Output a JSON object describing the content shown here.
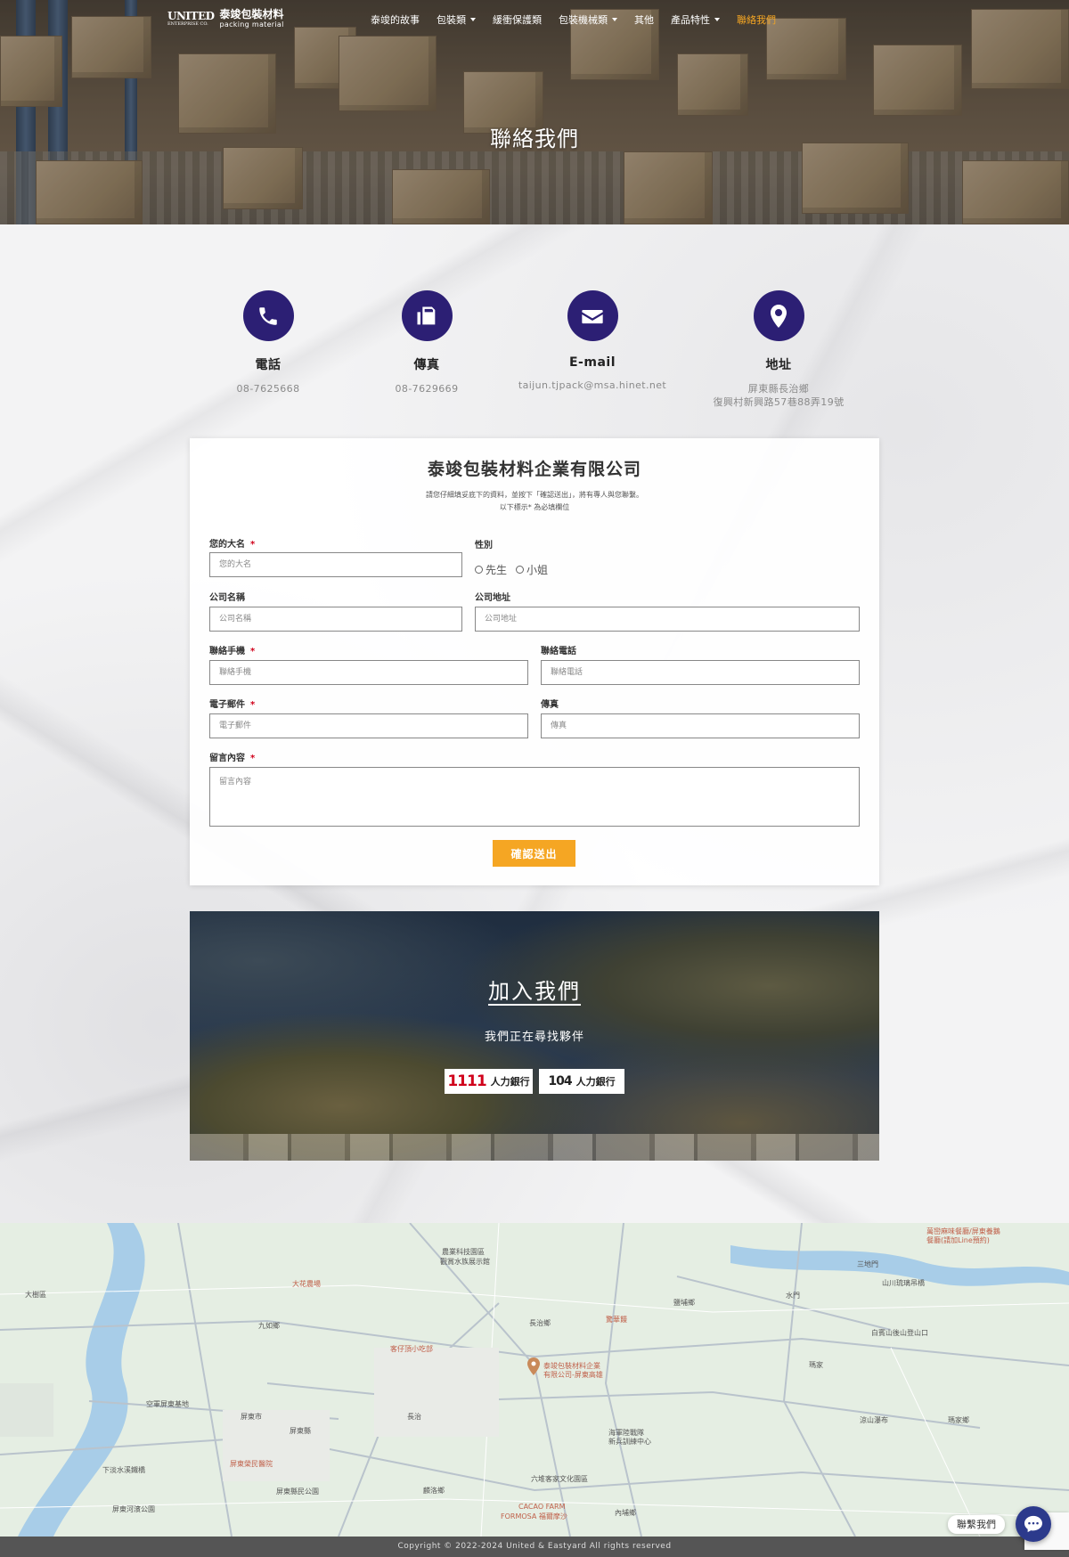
{
  "nav": {
    "logo_mark": "UNITED",
    "logo_mark_sub": "ENTERPRISE CO.",
    "logo_cn": "泰竣包裝材料",
    "logo_en": "packing material",
    "items": [
      {
        "label": "泰竣的故事",
        "dropdown": false
      },
      {
        "label": "包裝類",
        "dropdown": true
      },
      {
        "label": "緩衝保護類",
        "dropdown": false
      },
      {
        "label": "包裝機械類",
        "dropdown": true
      },
      {
        "label": "其他",
        "dropdown": false
      },
      {
        "label": "產品特性",
        "dropdown": true
      },
      {
        "label": "聯絡我們",
        "dropdown": false,
        "active": true
      }
    ]
  },
  "hero": {
    "title": "聯絡我們"
  },
  "contact": [
    {
      "icon": "phone-icon",
      "title": "電話",
      "value": "08-7625668"
    },
    {
      "icon": "fax-icon",
      "title": "傳真",
      "value": "08-7629669"
    },
    {
      "icon": "email-icon",
      "title": "E-mail",
      "value": "taijun.tjpack@msa.hinet.net"
    },
    {
      "icon": "location-pin-icon",
      "title": "地址",
      "value": "屏東縣長治鄉",
      "value2": "復興村新興路57巷88弄19號"
    }
  ],
  "form": {
    "title": "泰竣包裝材料企業有限公司",
    "note1": "請您仔細填妥底下的資料，並按下「確認送出」，將有專人與您聯繫。",
    "note2": "以下標示* 為必填欄位",
    "name_label": "您的大名",
    "name_placeholder": "您的大名",
    "gender_label": "性別",
    "gender_options": [
      "先生",
      "小姐"
    ],
    "company_label": "公司名稱",
    "company_placeholder": "公司名稱",
    "address_label": "公司地址",
    "address_placeholder": "公司地址",
    "mobile_label": "聯絡手機",
    "mobile_placeholder": "聯絡手機",
    "phone_label": "聯絡電話",
    "phone_placeholder": "聯絡電話",
    "email_label": "電子郵件",
    "email_placeholder": "電子郵件",
    "fax_label": "傳真",
    "fax_placeholder": "傳真",
    "message_label": "留言內容",
    "message_placeholder": "留言內容",
    "required_mark": "*",
    "submit_label": "確認送出"
  },
  "join": {
    "title": "加入我們",
    "subtitle": "我們正在尋找夥伴",
    "badges": [
      {
        "num": "1111",
        "text": "人力銀行"
      },
      {
        "num": "104",
        "text": "人力銀行"
      }
    ]
  },
  "map": {
    "labels": {
      "l1": "大樹區",
      "l2": "農業科技園區",
      "l3": "觀賞水族展示館",
      "l4": "大花農場",
      "l5": "長治鄉",
      "l6": "泰竣包裝材料企業",
      "l7": "有限公司-屏東高雄",
      "l8": "驚華饅",
      "l9": "客仔頂小吃部",
      "l10": "屏東縣",
      "l11": "長治",
      "l12": "屏東市",
      "l13": "海軍陸戰隊",
      "l14": "新兵訓練中心",
      "l15": "六堆客家文化園區",
      "l16": "麟洛鄉",
      "l17": "內埔鄉",
      "l18": "三地門",
      "l19": "水門",
      "l20": "瑪家",
      "l21": "涼山瀑布",
      "l22": "瑪家鄉",
      "l23": "白賓山後山登山口",
      "l24": "萬巒麻味餐廳/屏東養鵝",
      "l25": "餐廳(請加Line預約)",
      "l26": "空軍屏東基地",
      "l27": "屏東縣民公園",
      "l28": "屏東河濱公園",
      "l29": "下淡水溪鐵橋",
      "l30": "屏東榮民醫院",
      "l31": "CACAO FARM",
      "l32": "FORMOSA 福爾摩沙",
      "l33": "山川琉璃吊橋",
      "l34": "鹽埔鄉",
      "l35": "九如鄉"
    }
  },
  "footer": {
    "copyright": "Copyright © 2022-2024 United & Eastyard All rights reserved"
  },
  "chat": {
    "label": "聯繫我們"
  },
  "colors": {
    "accent": "#f5a623",
    "icon_circle": "#2c1f74",
    "required": "#d0021b",
    "footer": "#555555"
  }
}
